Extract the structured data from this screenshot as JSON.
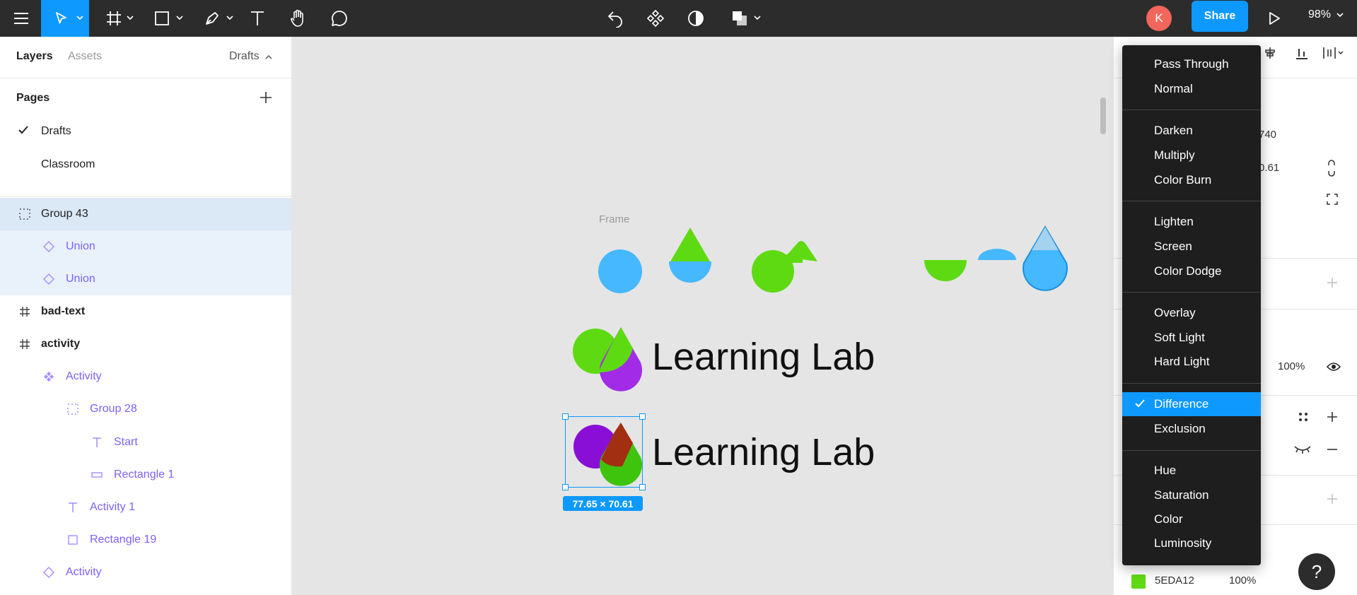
{
  "toolbar": {
    "avatar_initial": "K",
    "share_label": "Share",
    "zoom": "98%"
  },
  "left_panel": {
    "tabs": {
      "layers": "Layers",
      "assets": "Assets",
      "page_switch": "Drafts"
    },
    "pages_title": "Pages",
    "pages": [
      {
        "label": "Drafts",
        "checked": true
      },
      {
        "label": "Classroom",
        "checked": false
      }
    ],
    "layers": [
      {
        "label": "Group 43",
        "icon": "group-icon"
      },
      {
        "label": "Union",
        "icon": "union-icon"
      },
      {
        "label": "Union",
        "icon": "union-icon"
      },
      {
        "label": "bad-text",
        "icon": "frame-icon"
      },
      {
        "label": "activity",
        "icon": "frame-icon"
      },
      {
        "label": "Activity",
        "icon": "component-icon"
      },
      {
        "label": "Group 28",
        "icon": "group-icon"
      },
      {
        "label": "Start",
        "icon": "text-icon"
      },
      {
        "label": "Rectangle 1",
        "icon": "rectangle-icon"
      },
      {
        "label": "Activity 1",
        "icon": "text-icon"
      },
      {
        "label": "Rectangle 19",
        "icon": "rectangle-icon"
      },
      {
        "label": "Activity",
        "icon": "instance-icon"
      }
    ]
  },
  "canvas": {
    "frame_label": "Frame",
    "logo_text_1": "Learning Lab",
    "logo_text_2": "Learning Lab",
    "selection_dimensions": "77.65 × 70.61",
    "colors": {
      "green": "#5EDA12",
      "blue": "#46B8FF",
      "purple": "#A22BE8",
      "selection": "#0D99FF"
    }
  },
  "right_panel": {
    "value_w": "740",
    "value_h": "0.61",
    "opacity": "100%",
    "fill_hex": "5EDA12",
    "fill_opacity": "100%",
    "help": "?"
  },
  "blend_menu": {
    "groups": [
      [
        "Pass Through",
        "Normal"
      ],
      [
        "Darken",
        "Multiply",
        "Color Burn"
      ],
      [
        "Lighten",
        "Screen",
        "Color Dodge"
      ],
      [
        "Overlay",
        "Soft Light",
        "Hard Light"
      ],
      [
        "Difference",
        "Exclusion"
      ],
      [
        "Hue",
        "Saturation",
        "Color",
        "Luminosity"
      ]
    ],
    "selected": "Difference"
  }
}
